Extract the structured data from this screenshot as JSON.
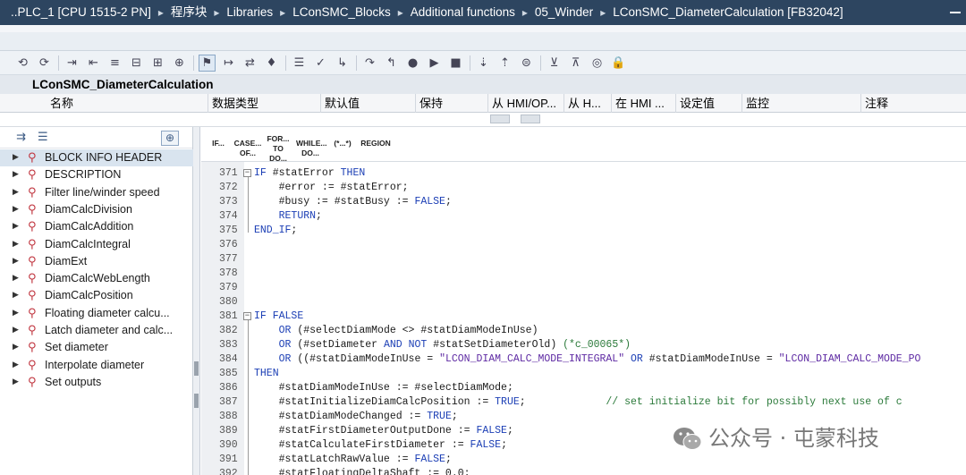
{
  "titlebar": {
    "crumbs": [
      "..PLC_1 [CPU 1515-2 PN]",
      "程序块",
      "Libraries",
      "LConSMC_Blocks",
      "Additional functions",
      "05_Winder",
      "LConSMC_DiameterCalculation [FB32042]"
    ]
  },
  "block": {
    "title": "LConSMC_DiameterCalculation"
  },
  "interface": {
    "columns": [
      "名称",
      "数据类型",
      "默认值",
      "保持",
      "从 HMI/OP...",
      "从 H...",
      "在 HMI ...",
      "设定值",
      "监控",
      "注释"
    ]
  },
  "toolbar": {
    "icons": [
      "monitor-off-icon",
      "monitor-on-icon",
      "insert-network-icon",
      "delete-network-icon",
      "indent-icon",
      "outdent-icon",
      "insert-row-icon",
      "add-row-icon",
      "pin-icon",
      "goto-icon",
      "toggle-icon",
      "bookmark-icon",
      "list-icon",
      "check-icon",
      "step-in-icon",
      "step-over-icon",
      "step-out-icon",
      "breakpoint-icon",
      "continue-icon",
      "stop-icon",
      "next-bookmark-icon",
      "prev-bookmark-icon",
      "compare-icon",
      "expand-icon",
      "collapse-icon",
      "watch-icon",
      "lock-icon"
    ]
  },
  "code_toolbar": {
    "buttons": [
      "IF...",
      "CASE... OF...",
      "FOR... TO DO...",
      "WHILE... DO...",
      "(*...*)",
      "REGION"
    ]
  },
  "tree": {
    "items": [
      "BLOCK INFO HEADER",
      "DESCRIPTION",
      "Filter line/winder speed",
      "DiamCalcDivision",
      "DiamCalcAddition",
      "DiamCalcIntegral",
      "DiamExt",
      "DiamCalcWebLength",
      "DiamCalcPosition",
      "Floating diameter calcu...",
      "Latch diameter and calc...",
      "Set diameter",
      "Interpolate diameter",
      "Set outputs"
    ]
  },
  "code": {
    "lines": [
      {
        "n": "371",
        "fold": "-",
        "t": "IF #statError THEN"
      },
      {
        "n": "372",
        "t": "    #error := #statError;"
      },
      {
        "n": "373",
        "t": "    #busy := #statBusy := FALSE;"
      },
      {
        "n": "374",
        "t": "    RETURN;"
      },
      {
        "n": "375",
        "t": "END_IF;"
      },
      {
        "n": "376",
        "t": ""
      },
      {
        "n": "377",
        "t": ""
      },
      {
        "n": "378",
        "t": ""
      },
      {
        "n": "379",
        "t": ""
      },
      {
        "n": "380",
        "t": ""
      },
      {
        "n": "381",
        "fold": "-",
        "t": "IF FALSE"
      },
      {
        "n": "382",
        "t": "    OR (#selectDiamMode <> #statDiamModeInUse)"
      },
      {
        "n": "383",
        "t": "    OR (#setDiameter AND NOT #statSetDiameterOld) (*c_00065*)"
      },
      {
        "n": "384",
        "t": "    OR ((#statDiamModeInUse = \"LCON_DIAM_CALC_MODE_INTEGRAL\" OR #statDiamModeInUse = \"LCON_DIAM_CALC_MODE_PO"
      },
      {
        "n": "385",
        "t": "THEN"
      },
      {
        "n": "386",
        "t": "    #statDiamModeInUse := #selectDiamMode;"
      },
      {
        "n": "387",
        "t": "    #statInitializeDiamCalcPosition := TRUE;             // set initialize bit for possibly next use of c"
      },
      {
        "n": "388",
        "t": "    #statDiamModeChanged := TRUE;"
      },
      {
        "n": "389",
        "t": "    #statFirstDiameterOutputDone := FALSE;"
      },
      {
        "n": "390",
        "t": "    #statCalculateFirstDiameter := FALSE;"
      },
      {
        "n": "391",
        "t": "    #statLatchRawValue := FALSE;"
      },
      {
        "n": "392",
        "t": "    #statFloatingDeltaShaft := 0.0;"
      }
    ]
  },
  "watermark": {
    "text": "公众号 · 屯蒙科技"
  }
}
